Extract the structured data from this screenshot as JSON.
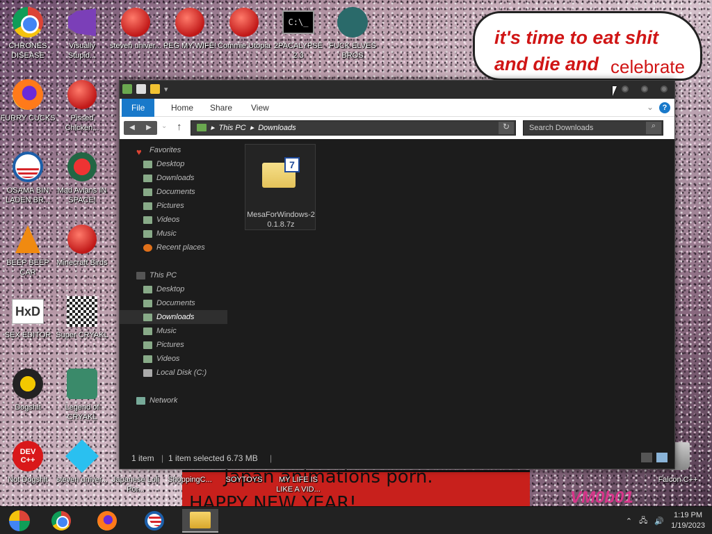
{
  "desktop": {
    "speech_bubble": {
      "line1": "it's time to eat shit",
      "line2": "and die and",
      "line3": "celebrate"
    },
    "banner_text": {
      "line1": "Japan animations porn.",
      "line2": "HAPPY NEW YEAR!"
    },
    "watermark": "VM0b01",
    "icons": [
      {
        "label": "CHRONES DISEASE",
        "icon": "chrome-icon"
      },
      {
        "label": "Visually Stupid...",
        "icon": "visual-studio-icon"
      },
      {
        "label": "steven univer...",
        "icon": "steven-universe-icon"
      },
      {
        "label": "PEG MY WIFE!",
        "icon": "peggle-icon"
      },
      {
        "label": "Commie Utopia",
        "icon": "commie-icon"
      },
      {
        "label": "2PACALYPSE 2.3",
        "icon": "cmd-icon"
      },
      {
        "label": "FUCK ELVES BROS",
        "icon": "elf-icon"
      },
      {
        "label": "FURRY CUCKS",
        "icon": "firefox-icon"
      },
      {
        "label": "Pissed Chicken...",
        "icon": "angry-birds-seasons-icon"
      },
      {
        "label": "OSAMA BIN LADEN BR...",
        "icon": "obama-logo-icon"
      },
      {
        "label": "Mad Avians IN SPACE!",
        "icon": "angry-birds-space-icon"
      },
      {
        "label": "BEEP BEEP CAR",
        "icon": "vlc-icon"
      },
      {
        "label": "Minecraft Birds",
        "icon": "angry-birds-icon"
      },
      {
        "label": "SEX EDITOR",
        "icon": "hxd-icon"
      },
      {
        "label": "Super CRYAKL",
        "icon": "pixel-cat-icon"
      },
      {
        "label": "Dogshit",
        "icon": "cpp-icon"
      },
      {
        "label": "Legend of CRYAKL",
        "icon": "pixel-character-icon"
      },
      {
        "label": "Not Dogshit",
        "icon": "devcpp-icon"
      },
      {
        "label": "steven univer...",
        "icon": "diamond-icon"
      },
      {
        "label": "Japanese Loli Por...",
        "icon": "generic-app-icon"
      },
      {
        "label": "ShoppingC...",
        "icon": "generic-app-icon"
      },
      {
        "label": "SOYTOYS",
        "icon": "generic-app-icon"
      },
      {
        "label": "MY LIFE IS LIKE A VID...",
        "icon": "generic-app-icon"
      },
      {
        "label": "Falcon C++",
        "icon": "recycle-bin-icon"
      }
    ]
  },
  "explorer": {
    "ribbon": {
      "file": "File",
      "home": "Home",
      "share": "Share",
      "view": "View",
      "help": "?"
    },
    "address": {
      "root": "This PC",
      "current": "Downloads"
    },
    "search_placeholder": "Search Downloads",
    "nav": {
      "favorites_header": "Favorites",
      "favorites": [
        "Desktop",
        "Downloads",
        "Documents",
        "Pictures",
        "Videos",
        "Music",
        "Recent places"
      ],
      "thispc_header": "This PC",
      "thispc": [
        "Desktop",
        "Documents",
        "Downloads",
        "Music",
        "Pictures",
        "Videos",
        "Local Disk (C:)"
      ],
      "network": "Network",
      "selected": "Downloads"
    },
    "files": [
      {
        "name": "MesaForWindows-20.1.8.7z",
        "icon": "7zip-archive-icon"
      }
    ],
    "status": {
      "count": "1 item",
      "selection": "1 item selected  6.73 MB"
    }
  },
  "taskbar": {
    "items": [
      "start-button",
      "chrome",
      "firefox",
      "obama-app",
      "file-explorer"
    ],
    "active": "file-explorer",
    "clock": {
      "time": "1:19 PM",
      "date": "1/19/2023"
    }
  }
}
